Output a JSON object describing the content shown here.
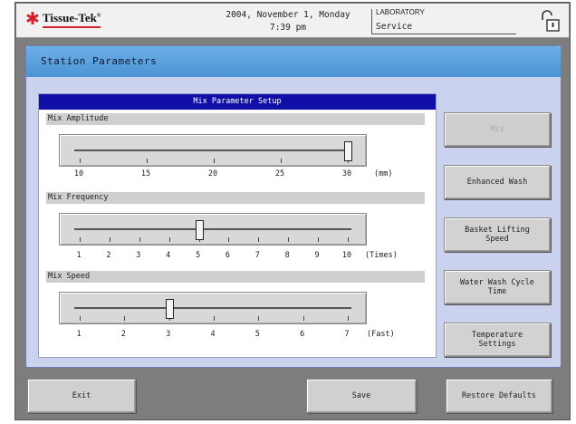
{
  "header": {
    "logo_text": "Tissue-Tek",
    "logo_mark": "®",
    "date_line": "2004, November 1, Monday",
    "time_line": "7:39 pm",
    "location": "LABORATORY",
    "role": "Service"
  },
  "panel": {
    "title": "Station Parameters"
  },
  "mix": {
    "title": "Mix Parameter Setup",
    "amplitude": {
      "label": "Mix Amplitude",
      "scale": [
        "10",
        "15",
        "20",
        "25",
        "30"
      ],
      "unit": "(mm)",
      "value": 30
    },
    "frequency": {
      "label": "Mix Frequency",
      "scale": [
        "1",
        "2",
        "3",
        "4",
        "5",
        "6",
        "7",
        "8",
        "9",
        "10"
      ],
      "unit": "(Times)",
      "value": 5
    },
    "speed": {
      "label": "Mix Speed",
      "scale": [
        "1",
        "2",
        "3",
        "4",
        "5",
        "6",
        "7"
      ],
      "unit": "(Fast)",
      "value": 3
    }
  },
  "side_buttons": {
    "mix": "Mix",
    "enhanced_wash": "Enhanced Wash",
    "basket_lifting_1": "Basket Lifting",
    "basket_lifting_2": "Speed",
    "water_wash_1": "Water Wash Cycle",
    "water_wash_2": "Time",
    "temperature_1": "Temperature",
    "temperature_2": "Settings"
  },
  "bottom_buttons": {
    "exit": "Exit",
    "save": "Save",
    "restore": "Restore Defaults"
  },
  "colors": {
    "title_bar": "#4a93d4",
    "card_header": "#1010a8",
    "panel_bg": "#cbd2ee",
    "logo_red": "#d6202a"
  }
}
